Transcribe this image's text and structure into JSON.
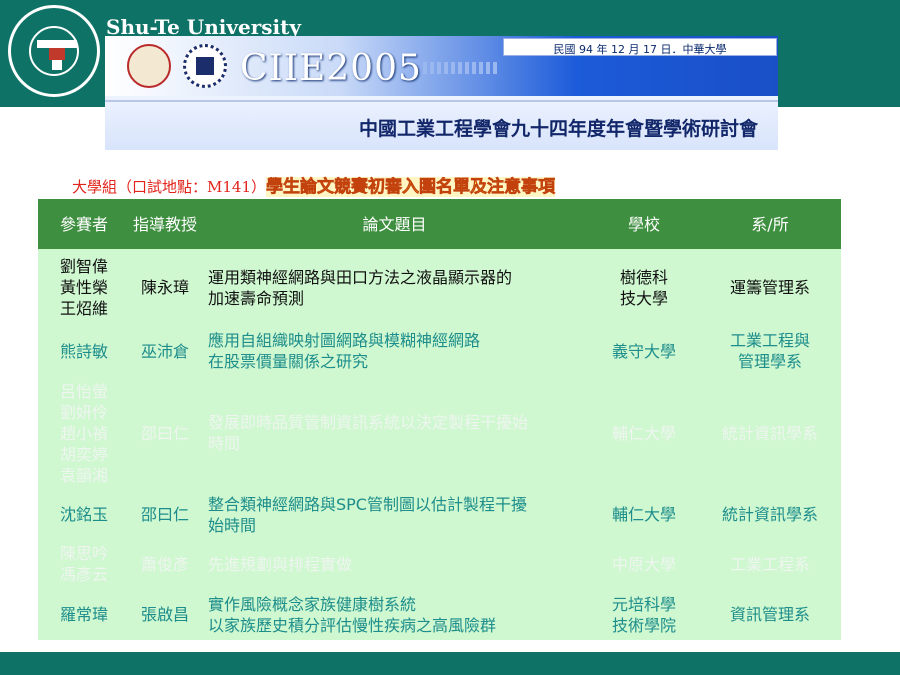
{
  "header": {
    "university": "Shu-Te University",
    "conference": "CIIE2005",
    "date_line": "民國 94 年 12 月 17 日．中華大學",
    "event_title": "中國工業工程學會九十四年度年會暨學術研討會"
  },
  "subtitle": {
    "group": "大學組（口試地點：M141）",
    "heading": "學生論文競賽初審入圍名單及注意事項"
  },
  "table": {
    "columns": [
      "參賽者",
      "指導教授",
      "論文題目",
      "學校",
      "系/所"
    ],
    "rows": [
      {
        "participants": [
          "劉智偉",
          "黃性榮",
          "王炤維"
        ],
        "advisor": "陳永璋",
        "title": [
          "運用類神經網路與田口方法之液晶顯示器的",
          "加速壽命預測"
        ],
        "school": [
          "樹德科",
          "技大學"
        ],
        "dept": [
          "運籌管理系"
        ]
      },
      {
        "participants": [
          "熊詩敏"
        ],
        "advisor": "巫沛倉",
        "title": [
          "應用自組織映射圖網路與模糊神經網路",
          "在股票價量關係之研究"
        ],
        "school": [
          "義守大學"
        ],
        "dept": [
          "工業工程與",
          "管理學系"
        ]
      },
      {
        "participants": [
          "呂怡螢",
          "劉妍伶",
          "趙小禎",
          "胡奕婷",
          "袁韻湘"
        ],
        "advisor": "邵曰仁",
        "title": [
          "發展即時品質管制資訊系統以決定製程干擾始",
          "時間"
        ],
        "school": [
          "輔仁大學"
        ],
        "dept": [
          "統計資訊學系"
        ]
      },
      {
        "participants": [
          "沈銘玉"
        ],
        "advisor": "邵曰仁",
        "title": [
          "整合類神經網路與SPC管制圖以估計製程干擾",
          "始時間"
        ],
        "school": [
          "輔仁大學"
        ],
        "dept": [
          "統計資訊學系"
        ]
      },
      {
        "participants": [
          "陳思吟",
          "馮彥云"
        ],
        "advisor": "蕭俊彥",
        "title": [
          "先進規劃與排程實做"
        ],
        "school": [
          "中原大學"
        ],
        "dept": [
          "工業工程系"
        ]
      },
      {
        "participants": [
          "羅常瑋"
        ],
        "advisor": "張啟昌",
        "title": [
          "實作風險概念家族健康樹系統",
          "以家族歷史積分評估慢性疾病之高風險群"
        ],
        "school": [
          "元培科學",
          "技術學院"
        ],
        "dept": [
          "資訊管理系"
        ]
      }
    ]
  },
  "colors": {
    "brand_teal": "#0e7366",
    "table_header": "#3e8f3f",
    "table_body": "#cff7d0",
    "text_teal": "#1d8e8b",
    "subtitle_red": "#e2231a",
    "subtitle_yellow": "#fde047"
  }
}
